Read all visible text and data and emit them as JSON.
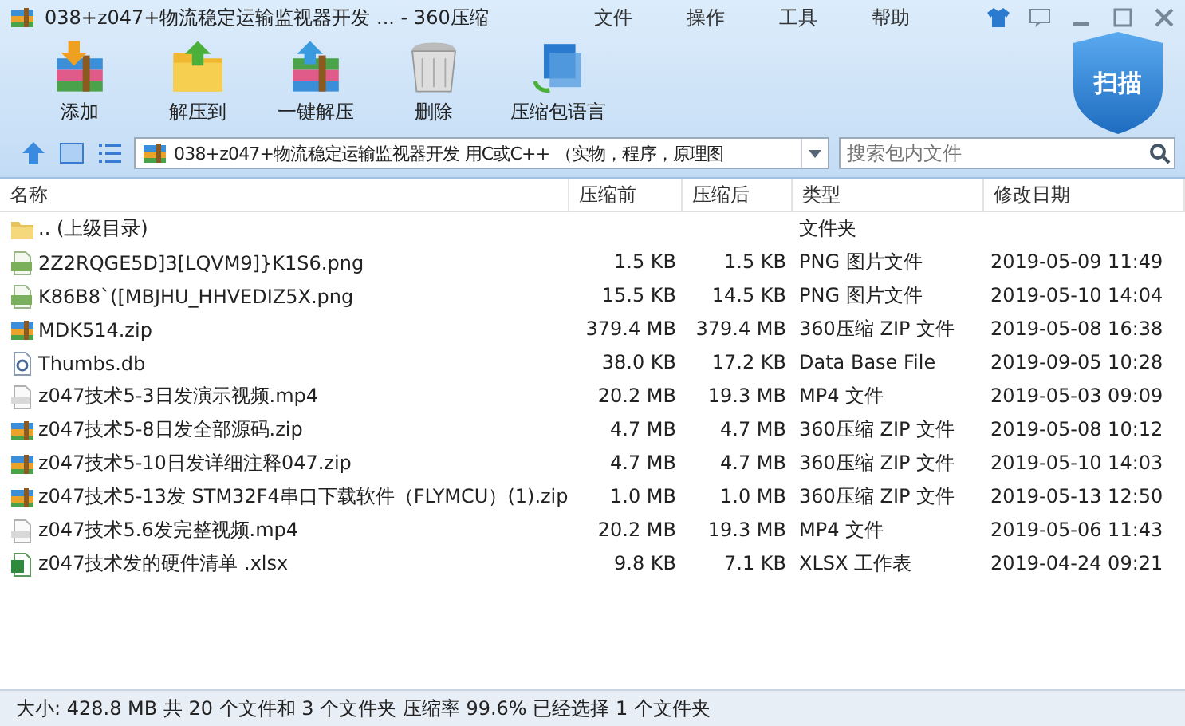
{
  "window": {
    "title": "038+z047+物流稳定运输监视器开发 ... - 360压缩"
  },
  "menu": [
    "文件",
    "操作",
    "工具",
    "帮助"
  ],
  "toolbar": [
    {
      "label": "添加",
      "kind": "add"
    },
    {
      "label": "解压到",
      "kind": "extract"
    },
    {
      "label": "一键解压",
      "kind": "oneclick"
    },
    {
      "label": "删除",
      "kind": "delete"
    },
    {
      "label": "压缩包语言",
      "kind": "language"
    }
  ],
  "scan_button": {
    "label": "扫描"
  },
  "path": {
    "value": "038+z047+物流稳定运输监视器开发 用C或C++ （实物，程序，原理图"
  },
  "search": {
    "placeholder": "搜索包内文件"
  },
  "table": {
    "columns": [
      "名称",
      "压缩前",
      "压缩后",
      "类型",
      "修改日期"
    ],
    "rows": [
      {
        "kind": "folder",
        "name": ".. (上级目录)",
        "before": "",
        "after": "",
        "type": "文件夹",
        "date": ""
      },
      {
        "kind": "png",
        "name": "2Z2RQGE5D]3[LQVM9]}K1S6.png",
        "before": "1.5 KB",
        "after": "1.5 KB",
        "type": "PNG 图片文件",
        "date": "2019-05-09 11:49"
      },
      {
        "kind": "png",
        "name": "K86B8`([MBJHU_HHVEDIZ5X.png",
        "before": "15.5 KB",
        "after": "14.5 KB",
        "type": "PNG 图片文件",
        "date": "2019-05-10 14:04"
      },
      {
        "kind": "zip",
        "name": "MDK514.zip",
        "before": "379.4 MB",
        "after": "379.4 MB",
        "type": "360压缩 ZIP 文件",
        "date": "2019-05-08 16:38"
      },
      {
        "kind": "db",
        "name": "Thumbs.db",
        "before": "38.0 KB",
        "after": "17.2 KB",
        "type": "Data Base File",
        "date": "2019-09-05 10:28"
      },
      {
        "kind": "mp4",
        "name": "z047技术5-3日发演示视频.mp4",
        "before": "20.2 MB",
        "after": "19.3 MB",
        "type": "MP4 文件",
        "date": "2019-05-03 09:09"
      },
      {
        "kind": "zip",
        "name": "z047技术5-8日发全部源码.zip",
        "before": "4.7 MB",
        "after": "4.7 MB",
        "type": "360压缩 ZIP 文件",
        "date": "2019-05-08 10:12"
      },
      {
        "kind": "zip",
        "name": "z047技术5-10日发详细注释047.zip",
        "before": "4.7 MB",
        "after": "4.7 MB",
        "type": "360压缩 ZIP 文件",
        "date": "2019-05-10 14:03"
      },
      {
        "kind": "zip",
        "name": "z047技术5-13发 STM32F4串口下载软件（FLYMCU）(1).zip",
        "before": "1.0 MB",
        "after": "1.0 MB",
        "type": "360压缩 ZIP 文件",
        "date": "2019-05-13 12:50"
      },
      {
        "kind": "mp4",
        "name": "z047技术5.6发完整视频.mp4",
        "before": "20.2 MB",
        "after": "19.3 MB",
        "type": "MP4 文件",
        "date": "2019-05-06 11:43"
      },
      {
        "kind": "xlsx",
        "name": "z047技术发的硬件清单 .xlsx",
        "before": "9.8 KB",
        "after": "7.1 KB",
        "type": "XLSX 工作表",
        "date": "2019-04-24 09:21"
      }
    ]
  },
  "status_bar": "大小: 428.8 MB 共 20 个文件和 3 个文件夹 压缩率 99.6% 已经选择 1 个文件夹"
}
